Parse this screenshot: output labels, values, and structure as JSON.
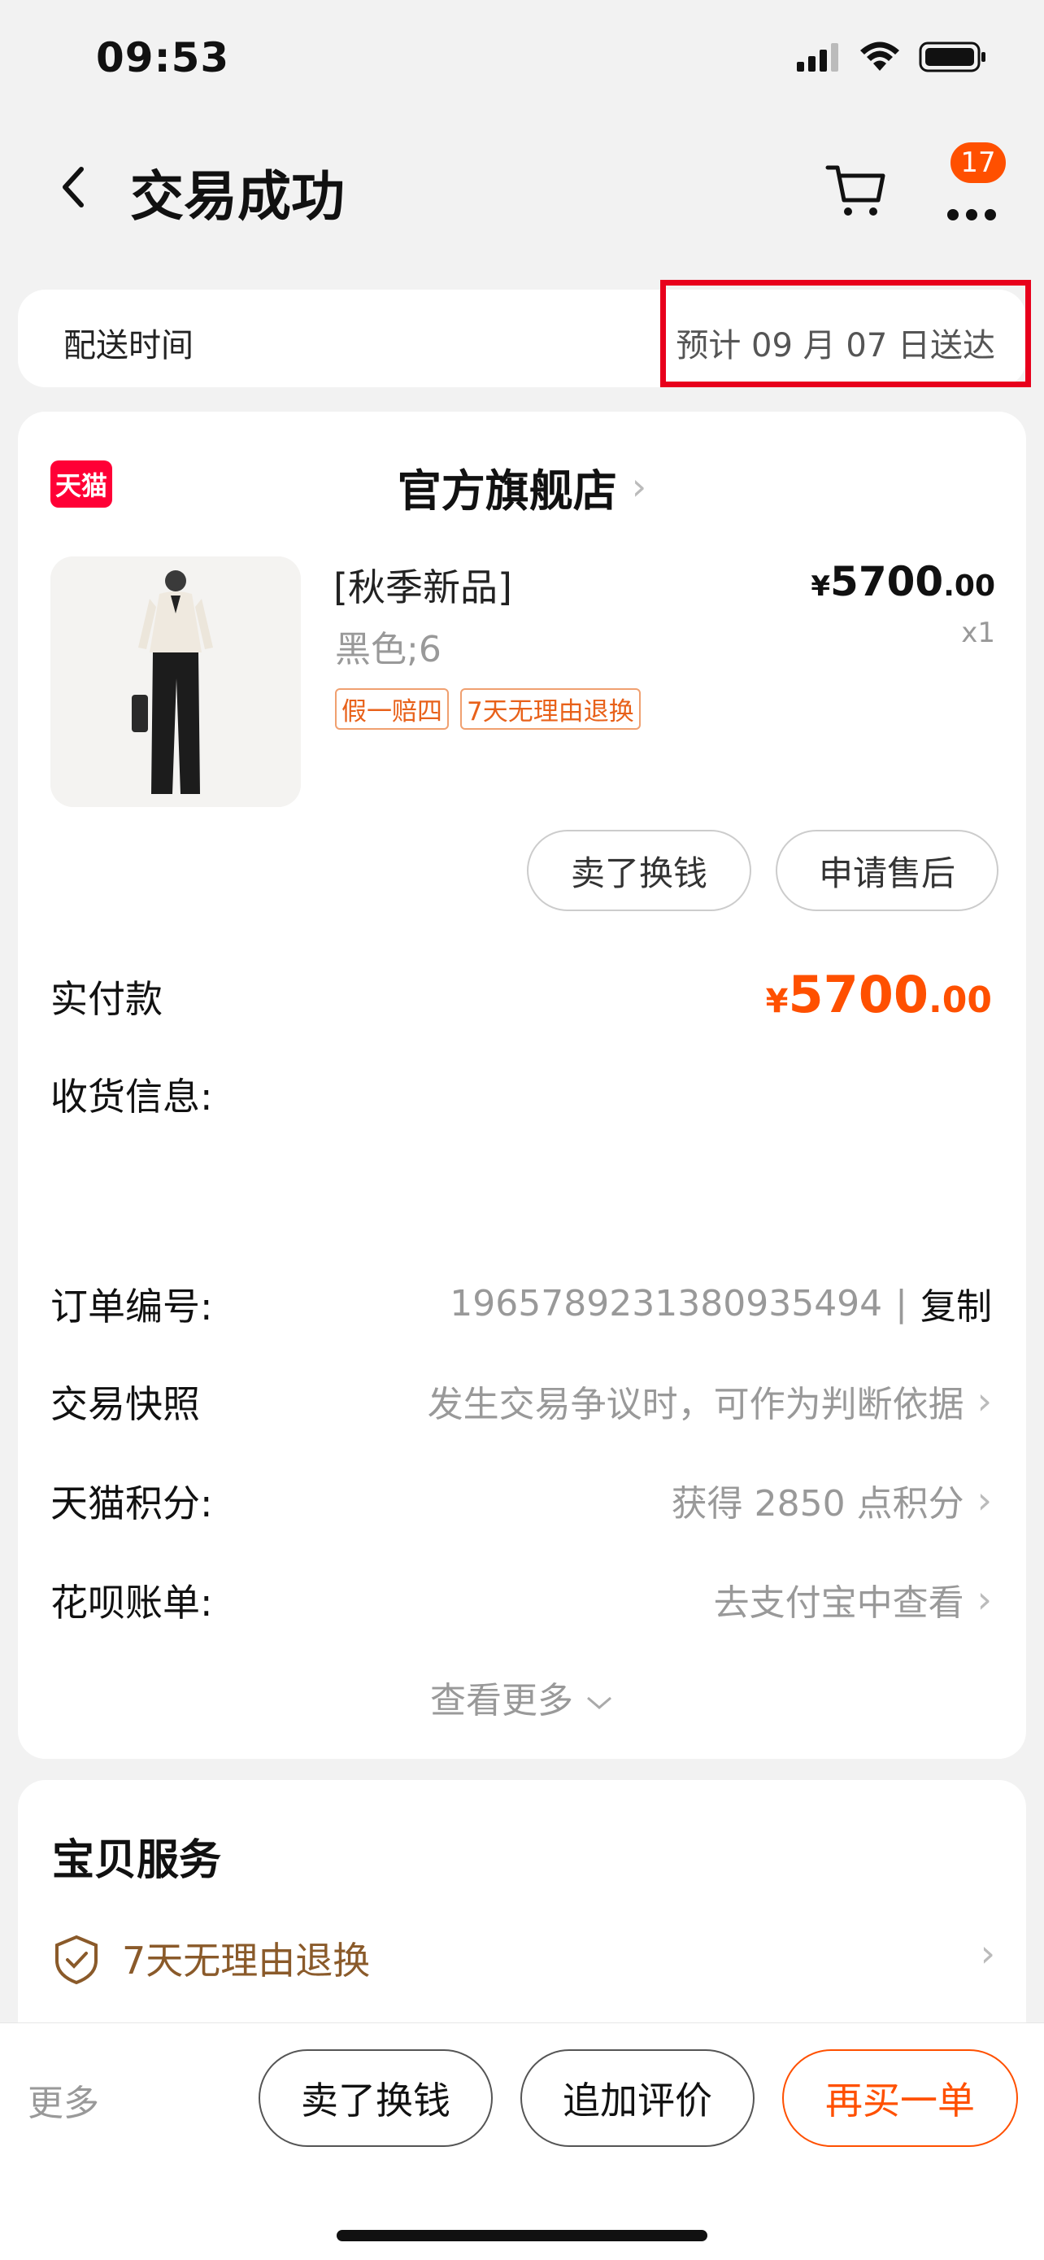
{
  "status_bar": {
    "time": "09:53"
  },
  "nav": {
    "title": "交易成功",
    "badge_count": "17"
  },
  "delivery": {
    "label": "配送时间",
    "value": "预计 09 月 07 日送达"
  },
  "shop": {
    "logo_text": "天猫",
    "name": "官方旗舰店"
  },
  "product": {
    "title": "[秋季新品]",
    "sku": "黑色;6",
    "tags": [
      "假一赔四",
      "7天无理由退换"
    ],
    "price_currency": "¥",
    "price_int": "5700",
    "price_dec": ".00",
    "quantity": "x1"
  },
  "actions": {
    "sell": "卖了换钱",
    "after_sales": "申请售后"
  },
  "order_info": {
    "paid_label": "实付款",
    "paid_currency": "¥",
    "paid_int": "5700",
    "paid_dec": ".00",
    "address_label": "收货信息:",
    "order_no_label": "订单编号:",
    "order_no": "1965789231380935494",
    "separator": "|",
    "copy_label": "复制",
    "snapshot_label": "交易快照",
    "snapshot_value": "发生交易争议时，可作为判断依据",
    "points_label": "天猫积分:",
    "points_value": "获得 2850 点积分",
    "huabei_label": "花呗账单:",
    "huabei_value": "去支付宝中查看",
    "see_more": "查看更多"
  },
  "service": {
    "title": "宝贝服务",
    "item": "7天无理由退换"
  },
  "bottom_bar": {
    "more": "更多",
    "sell": "卖了换钱",
    "review": "追加评价",
    "rebuy": "再买一单"
  },
  "colors": {
    "accent": "#ff5000",
    "tmall_red": "#ff0036",
    "highlight": "#e8001c"
  }
}
